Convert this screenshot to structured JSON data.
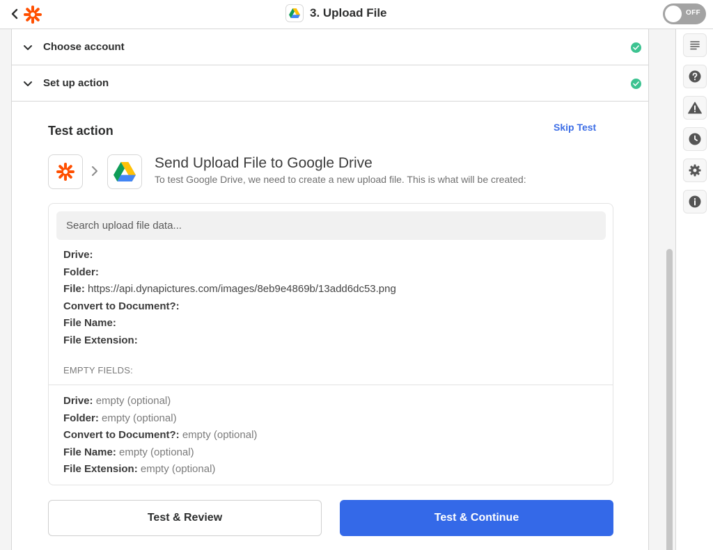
{
  "header": {
    "title": "3. Upload File",
    "toggle_label": "OFF"
  },
  "steps": [
    {
      "label": "Choose account"
    },
    {
      "label": "Set up action"
    }
  ],
  "test": {
    "title": "Test action",
    "skip_label": "Skip Test",
    "send_title": "Send Upload File to Google Drive",
    "send_subtitle": "To test Google Drive, we need to create a new upload file. This is what will be created:",
    "search_placeholder": "Search upload file data...",
    "fields": [
      {
        "label": "Drive:",
        "value": ""
      },
      {
        "label": "Folder:",
        "value": ""
      },
      {
        "label": "File:",
        "value": "https://api.dynapictures.com/images/8eb9e4869b/13add6dc53.png"
      },
      {
        "label": "Convert to Document?:",
        "value": ""
      },
      {
        "label": "File Name:",
        "value": ""
      },
      {
        "label": "File Extension:",
        "value": ""
      }
    ],
    "empty_header": "EMPTY FIELDS:",
    "empty_fields": [
      {
        "label": "Drive:",
        "value": "empty (optional)"
      },
      {
        "label": "Folder:",
        "value": "empty (optional)"
      },
      {
        "label": "Convert to Document?:",
        "value": "empty (optional)"
      },
      {
        "label": "File Name:",
        "value": "empty (optional)"
      },
      {
        "label": "File Extension:",
        "value": "empty (optional)"
      }
    ]
  },
  "buttons": {
    "review": "Test & Review",
    "continue": "Test & Continue"
  },
  "sidebar_icons": [
    "outline-icon",
    "help-icon",
    "alert-icon",
    "history-icon",
    "settings-icon",
    "info-icon"
  ],
  "colors": {
    "brand_orange": "#ff4f00",
    "primary_blue": "#3469e8",
    "link_blue": "#3d6ee6",
    "success_green": "#3dc391"
  }
}
